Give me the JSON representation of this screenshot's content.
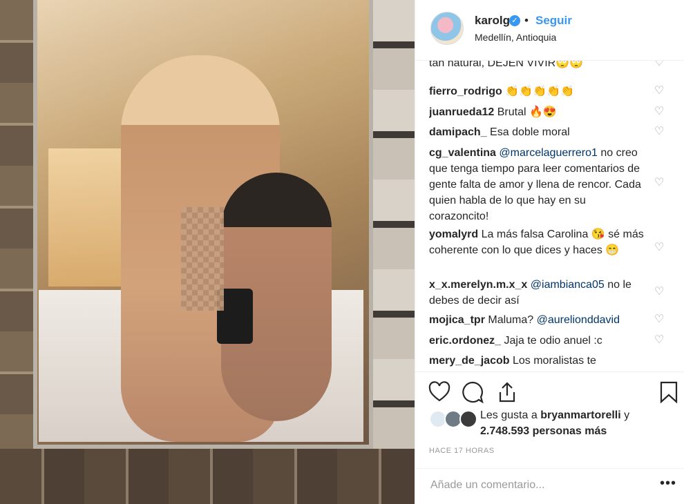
{
  "post": {
    "username": "karolg",
    "follow_label": "Seguir",
    "location": "Medellín, Antioquia"
  },
  "comments": [
    {
      "user": "",
      "text": "tan natural, DEJEN VIVIR🙄🙄"
    },
    {
      "user": "fierro_rodrigo",
      "text": "👏👏👏👏👏"
    },
    {
      "user": "juanrueda12",
      "text": "Brutal 🔥😍"
    },
    {
      "user": "damipach_",
      "text": "Esa doble moral"
    },
    {
      "user": "cg_valentina",
      "mention": "@marcelaguerrero1",
      "text": "no creo que tenga tiempo para leer comentarios de gente falta de amor y llena de rencor. Cada quien habla de lo que hay en su corazoncito!"
    },
    {
      "user": "yomalyrd",
      "text": "La más falsa Carolina 😘 sé más coherente con lo que dices y haces 😁"
    },
    {
      "user": "x_x.merelyn.m.x_x",
      "mention": "@iambianca05",
      "text": "no le debes de decir así"
    },
    {
      "user": "mojica_tpr",
      "text": "Maluma?",
      "mention": "@aurelionddavid"
    },
    {
      "user": "eric.ordonez_",
      "text": "Jaja te odio anuel :c"
    },
    {
      "user": "mery_de_jacob",
      "text": "Los moralistas te"
    }
  ],
  "likes": {
    "prefix": "Les gusta a",
    "user": "bryanmartorelli",
    "conj": "y",
    "count": "2.748.593 personas más"
  },
  "timestamp": "HACE 17 HORAS",
  "add_comment": {
    "placeholder": "Añade un comentario..."
  },
  "colors": {
    "accent": "#3897f0",
    "text": "#262626",
    "muted": "#999999"
  }
}
